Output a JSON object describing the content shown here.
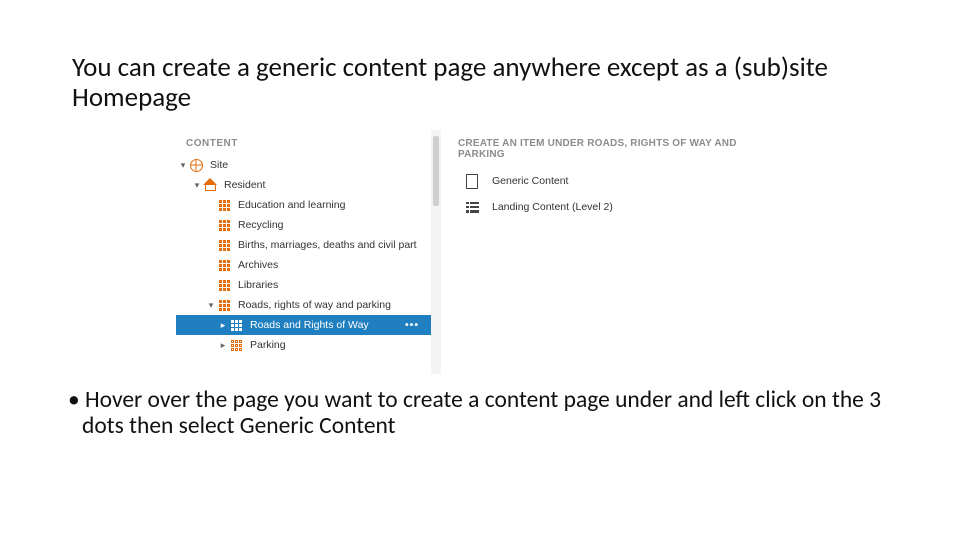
{
  "title": "You can create a generic content page anywhere except as a (sub)site Homepage",
  "bullet": "Hover over the page you want to create a content page under and left click on the 3 dots then select Generic Content",
  "left": {
    "header": "CONTENT",
    "site": "Site",
    "resident": "Resident",
    "items": [
      "Education and learning",
      "Recycling",
      "Births, marriages, deaths and civil part",
      "Archives",
      "Libraries",
      "Roads, rights of way and parking"
    ],
    "selected": "Roads and Rights of Way",
    "dots": "•••",
    "after_selected": "Parking"
  },
  "right": {
    "header": "CREATE AN ITEM UNDER ROADS, RIGHTS OF WAY AND PARKING",
    "options": [
      "Generic Content",
      "Landing Content (Level 2)"
    ]
  }
}
